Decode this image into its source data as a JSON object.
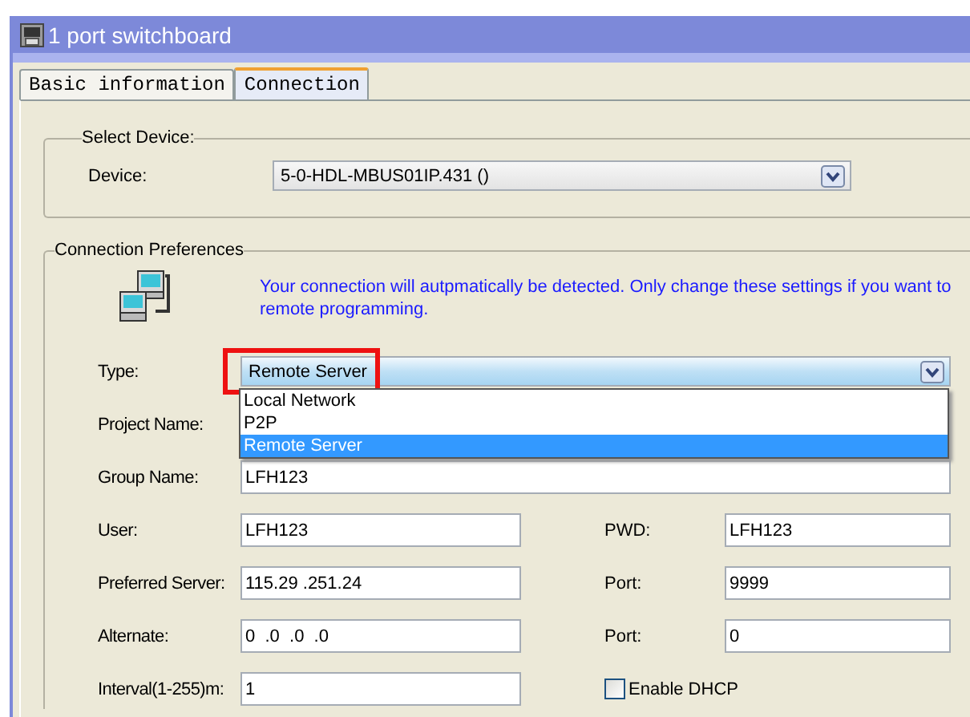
{
  "window": {
    "title": "1 port switchboard"
  },
  "tabs": [
    {
      "label": "Basic information",
      "selected": false
    },
    {
      "label": "Connection",
      "selected": true
    }
  ],
  "select_device": {
    "title": "Select Device:",
    "device_label": "Device:",
    "device_value": "5-0-HDL-MBUS01IP.431 ()"
  },
  "connection_preferences": {
    "title": "Connection Preferences",
    "notice": "Your connection will autpmatically be detected. Only change these settings if you want to remote programming.",
    "type_label": "Type:",
    "type_value": "Remote Server",
    "type_highlighted": true,
    "type_expanded": true,
    "type_options": [
      {
        "label": "Local Network",
        "selected": false
      },
      {
        "label": "P2P",
        "selected": false
      },
      {
        "label": "Remote Server",
        "selected": true
      }
    ],
    "rows": [
      {
        "kind": "label",
        "label": "Project Name:"
      },
      {
        "kind": "wide",
        "label": "Group Name:",
        "value": "LFH123"
      },
      {
        "kind": "pair",
        "label": "User:",
        "value": "LFH123",
        "right": {
          "kind": "field",
          "label": "PWD:",
          "value": "LFH123"
        }
      },
      {
        "kind": "pair",
        "label": "Preferred Server:",
        "value": "115.29 .251.24",
        "right": {
          "kind": "field",
          "label": "Port:",
          "value": "9999"
        }
      },
      {
        "kind": "pair",
        "label": "Alternate:",
        "value": "0  .0  .0  .0",
        "right": {
          "kind": "field",
          "label": "Port:",
          "value": "0"
        }
      },
      {
        "kind": "pair",
        "label": "Interval(1-255)m:",
        "value": "1",
        "right": {
          "kind": "checkbox",
          "label": "Enable DHCP",
          "checked": false
        }
      }
    ]
  }
}
